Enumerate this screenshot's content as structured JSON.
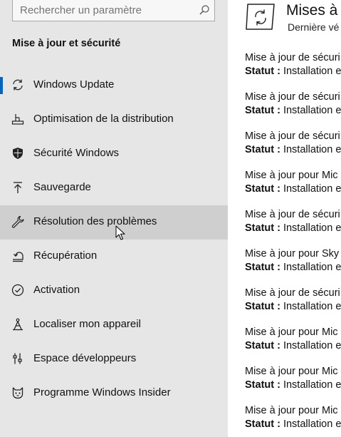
{
  "search": {
    "placeholder": "Rechercher un paramètre"
  },
  "sidebar": {
    "section_title": "Mise à jour et sécurité",
    "items": [
      {
        "label": "Windows Update",
        "icon": "sync-icon"
      },
      {
        "label": "Optimisation de la distribution",
        "icon": "delivery-icon"
      },
      {
        "label": "Sécurité Windows",
        "icon": "shield-icon"
      },
      {
        "label": "Sauvegarde",
        "icon": "backup-icon"
      },
      {
        "label": "Résolution des problèmes",
        "icon": "wrench-icon"
      },
      {
        "label": "Récupération",
        "icon": "recovery-icon"
      },
      {
        "label": "Activation",
        "icon": "check-circle-icon"
      },
      {
        "label": "Localiser mon appareil",
        "icon": "find-device-icon"
      },
      {
        "label": "Espace développeurs",
        "icon": "developer-icon"
      },
      {
        "label": "Programme Windows Insider",
        "icon": "insider-cat-icon"
      }
    ]
  },
  "main": {
    "title": "Mises à j",
    "subtitle": "Dernière vé",
    "status_label": "Statut :",
    "updates": [
      {
        "name": "Mise à jour de sécuri",
        "status": "Installation e"
      },
      {
        "name": "Mise à jour de sécuri",
        "status": "Installation e"
      },
      {
        "name": "Mise à jour de sécuri",
        "status": "Installation e"
      },
      {
        "name": "Mise à jour pour Mic",
        "status": "Installation e"
      },
      {
        "name": "Mise à jour de sécuri",
        "status": "Installation e"
      },
      {
        "name": "Mise à jour pour Sky",
        "status": "Installation e"
      },
      {
        "name": "Mise à jour de sécuri",
        "status": "Installation e"
      },
      {
        "name": "Mise à jour pour Mic",
        "status": "Installation e"
      },
      {
        "name": "Mise à jour pour Mic",
        "status": "Installation e"
      },
      {
        "name": "Mise à jour pour Mic",
        "status": "Installation e"
      }
    ]
  },
  "colors": {
    "sidebar_bg": "#e6e6e6",
    "hover_bg": "#cfcfcf",
    "accent": "#0067c0"
  }
}
